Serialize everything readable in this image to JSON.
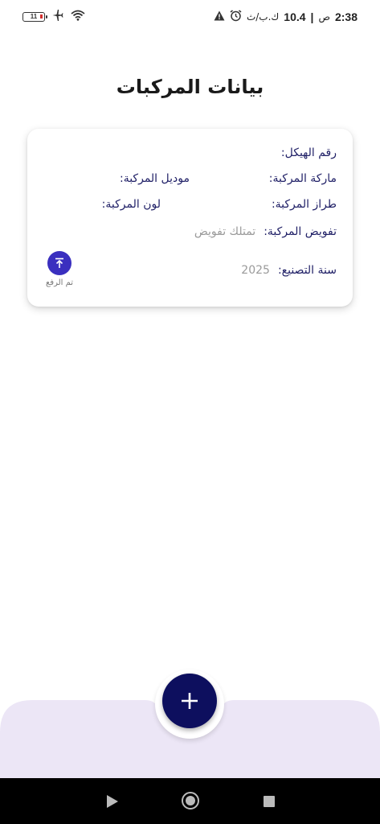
{
  "status_bar": {
    "time": "2:38",
    "am_pm": "ص",
    "separator": "|",
    "network_speed": "10.4",
    "speed_unit": "ك.ب/ث",
    "battery_level": "11"
  },
  "page": {
    "title": "بيانات المركبات"
  },
  "vehicle_card": {
    "chassis_label": "رقم الهيكل:",
    "chassis_value": "",
    "brand_label": "ماركة المركبة:",
    "brand_value": "",
    "model_label": "موديل المركبة:",
    "model_value": "",
    "type_label": "طراز المركبة:",
    "type_value": "",
    "color_label": "لون المركبة:",
    "color_value": "",
    "authorization_label": "تفويض المركبة:",
    "authorization_value": "تمتلك تفويض",
    "year_label": "سنة التصنيع:",
    "year_value": "2025",
    "upload_status": "تم الرفع"
  },
  "fab": {
    "icon": "plus-icon"
  },
  "colors": {
    "accent": "#0d0f5e",
    "upload": "#3a2fbf",
    "label_text": "#1f1f66",
    "muted_text": "#9a9a9a",
    "bottom_bar": "#ece6f6"
  }
}
